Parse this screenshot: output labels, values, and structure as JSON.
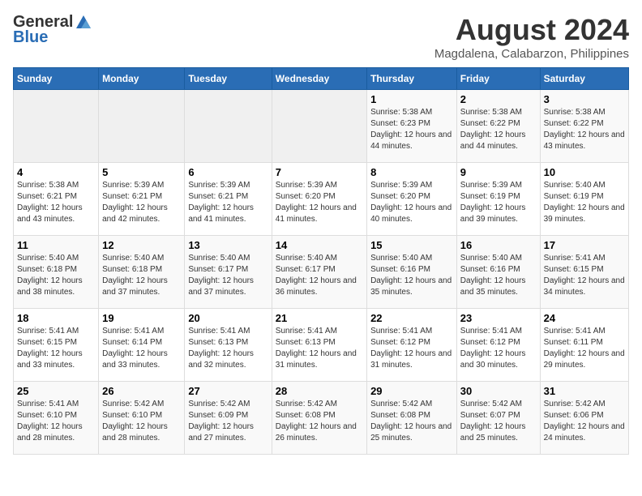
{
  "header": {
    "logo_general": "General",
    "logo_blue": "Blue",
    "title": "August 2024",
    "subtitle": "Magdalena, Calabarzon, Philippines"
  },
  "calendar": {
    "days_of_week": [
      "Sunday",
      "Monday",
      "Tuesday",
      "Wednesday",
      "Thursday",
      "Friday",
      "Saturday"
    ],
    "weeks": [
      {
        "days": [
          {
            "number": "",
            "empty": true
          },
          {
            "number": "",
            "empty": true
          },
          {
            "number": "",
            "empty": true
          },
          {
            "number": "",
            "empty": true
          },
          {
            "number": "1",
            "sunrise": "5:38 AM",
            "sunset": "6:23 PM",
            "daylight": "12 hours and 44 minutes."
          },
          {
            "number": "2",
            "sunrise": "5:38 AM",
            "sunset": "6:22 PM",
            "daylight": "12 hours and 44 minutes."
          },
          {
            "number": "3",
            "sunrise": "5:38 AM",
            "sunset": "6:22 PM",
            "daylight": "12 hours and 43 minutes."
          }
        ]
      },
      {
        "days": [
          {
            "number": "4",
            "sunrise": "5:38 AM",
            "sunset": "6:21 PM",
            "daylight": "12 hours and 43 minutes."
          },
          {
            "number": "5",
            "sunrise": "5:39 AM",
            "sunset": "6:21 PM",
            "daylight": "12 hours and 42 minutes."
          },
          {
            "number": "6",
            "sunrise": "5:39 AM",
            "sunset": "6:21 PM",
            "daylight": "12 hours and 41 minutes."
          },
          {
            "number": "7",
            "sunrise": "5:39 AM",
            "sunset": "6:20 PM",
            "daylight": "12 hours and 41 minutes."
          },
          {
            "number": "8",
            "sunrise": "5:39 AM",
            "sunset": "6:20 PM",
            "daylight": "12 hours and 40 minutes."
          },
          {
            "number": "9",
            "sunrise": "5:39 AM",
            "sunset": "6:19 PM",
            "daylight": "12 hours and 39 minutes."
          },
          {
            "number": "10",
            "sunrise": "5:40 AM",
            "sunset": "6:19 PM",
            "daylight": "12 hours and 39 minutes."
          }
        ]
      },
      {
        "days": [
          {
            "number": "11",
            "sunrise": "5:40 AM",
            "sunset": "6:18 PM",
            "daylight": "12 hours and 38 minutes."
          },
          {
            "number": "12",
            "sunrise": "5:40 AM",
            "sunset": "6:18 PM",
            "daylight": "12 hours and 37 minutes."
          },
          {
            "number": "13",
            "sunrise": "5:40 AM",
            "sunset": "6:17 PM",
            "daylight": "12 hours and 37 minutes."
          },
          {
            "number": "14",
            "sunrise": "5:40 AM",
            "sunset": "6:17 PM",
            "daylight": "12 hours and 36 minutes."
          },
          {
            "number": "15",
            "sunrise": "5:40 AM",
            "sunset": "6:16 PM",
            "daylight": "12 hours and 35 minutes."
          },
          {
            "number": "16",
            "sunrise": "5:40 AM",
            "sunset": "6:16 PM",
            "daylight": "12 hours and 35 minutes."
          },
          {
            "number": "17",
            "sunrise": "5:41 AM",
            "sunset": "6:15 PM",
            "daylight": "12 hours and 34 minutes."
          }
        ]
      },
      {
        "days": [
          {
            "number": "18",
            "sunrise": "5:41 AM",
            "sunset": "6:15 PM",
            "daylight": "12 hours and 33 minutes."
          },
          {
            "number": "19",
            "sunrise": "5:41 AM",
            "sunset": "6:14 PM",
            "daylight": "12 hours and 33 minutes."
          },
          {
            "number": "20",
            "sunrise": "5:41 AM",
            "sunset": "6:13 PM",
            "daylight": "12 hours and 32 minutes."
          },
          {
            "number": "21",
            "sunrise": "5:41 AM",
            "sunset": "6:13 PM",
            "daylight": "12 hours and 31 minutes."
          },
          {
            "number": "22",
            "sunrise": "5:41 AM",
            "sunset": "6:12 PM",
            "daylight": "12 hours and 31 minutes."
          },
          {
            "number": "23",
            "sunrise": "5:41 AM",
            "sunset": "6:12 PM",
            "daylight": "12 hours and 30 minutes."
          },
          {
            "number": "24",
            "sunrise": "5:41 AM",
            "sunset": "6:11 PM",
            "daylight": "12 hours and 29 minutes."
          }
        ]
      },
      {
        "days": [
          {
            "number": "25",
            "sunrise": "5:41 AM",
            "sunset": "6:10 PM",
            "daylight": "12 hours and 28 minutes."
          },
          {
            "number": "26",
            "sunrise": "5:42 AM",
            "sunset": "6:10 PM",
            "daylight": "12 hours and 28 minutes."
          },
          {
            "number": "27",
            "sunrise": "5:42 AM",
            "sunset": "6:09 PM",
            "daylight": "12 hours and 27 minutes."
          },
          {
            "number": "28",
            "sunrise": "5:42 AM",
            "sunset": "6:08 PM",
            "daylight": "12 hours and 26 minutes."
          },
          {
            "number": "29",
            "sunrise": "5:42 AM",
            "sunset": "6:08 PM",
            "daylight": "12 hours and 25 minutes."
          },
          {
            "number": "30",
            "sunrise": "5:42 AM",
            "sunset": "6:07 PM",
            "daylight": "12 hours and 25 minutes."
          },
          {
            "number": "31",
            "sunrise": "5:42 AM",
            "sunset": "6:06 PM",
            "daylight": "12 hours and 24 minutes."
          }
        ]
      }
    ]
  }
}
